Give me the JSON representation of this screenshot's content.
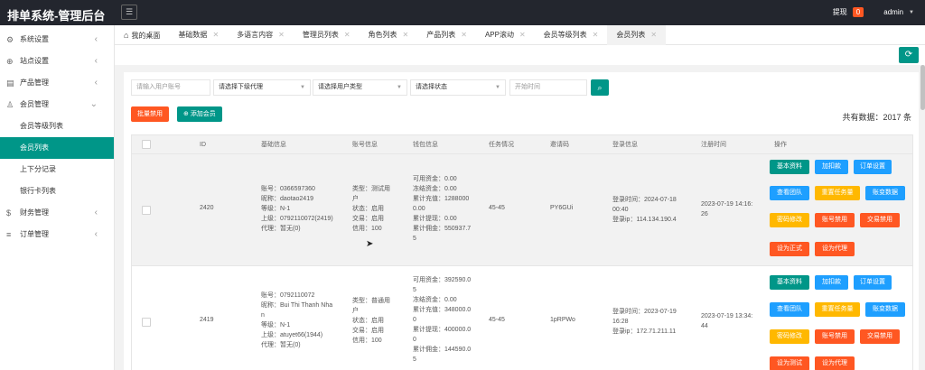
{
  "header": {
    "brand": "排单系统-管理后台",
    "menu_icon": "☰",
    "withdraw_label": "提现",
    "withdraw_count": "0",
    "user": "admin"
  },
  "sidebar": {
    "items": [
      {
        "label": "系统设置",
        "icon": "⚙"
      },
      {
        "label": "站点设置",
        "icon": "⊕"
      },
      {
        "label": "产品管理",
        "icon": "▤"
      },
      {
        "label": "会员管理",
        "icon": "♙"
      }
    ],
    "sub": [
      "会员等级列表",
      "会员列表",
      "上下分记录",
      "银行卡列表"
    ],
    "bottom": [
      {
        "label": "财务管理",
        "icon": "$"
      },
      {
        "label": "订单管理",
        "icon": "≡"
      }
    ]
  },
  "tabs": [
    "我的桌面",
    "基础数据",
    "多语言内容",
    "管理员列表",
    "角色列表",
    "产品列表",
    "APP滚动",
    "会员等级列表",
    "会员列表"
  ],
  "filters": {
    "account_placeholder": "请输入用户账号",
    "agent": "请选择下级代理",
    "user_type": "请选择用户类型",
    "status": "请选择状态",
    "start_time": "开始时间"
  },
  "actions": {
    "batch_disable": "批量禁用",
    "add_member": "添加会员",
    "total": "共有数据：2017 条"
  },
  "columns": [
    "ID",
    "基础信息",
    "账号信息",
    "钱包信息",
    "任务情况",
    "邀请码",
    "登录信息",
    "注册时间",
    "操作"
  ],
  "rows": [
    {
      "id": "2420",
      "basic": [
        "账号：0366597360",
        "昵称：daotao2419",
        "等级：N-1",
        "上级：0792110072(2419)",
        "代理：暂无(0)"
      ],
      "account": [
        "类型：测试用",
        "户",
        "状态：启用",
        "交易：启用",
        "信用：100"
      ],
      "wallet": [
        "可用资金：0.00",
        "冻结资金：0.00",
        "累计充值：1288000",
        "0.00",
        "累计提现：0.00",
        "累计佣金：550937.7",
        "5"
      ],
      "task": "45-45",
      "invite": "PY6GUi",
      "login": [
        "登录时间：2024-07-18",
        "00:40",
        "登录ip：114.134.190.4"
      ],
      "reg": [
        "2023-07-19 14:16:",
        "26"
      ],
      "ops": [
        [
          "基本资料",
          "加扣款",
          "订单设置"
        ],
        [
          "查看团队",
          "重置任务量",
          "账变数据"
        ],
        [
          "密码修改",
          "账号禁用",
          "交易禁用"
        ],
        [
          "设为正式",
          "设为代理"
        ]
      ]
    },
    {
      "id": "2419",
      "basic": [
        "账号：0792110072",
        "昵称：Bui Thi Thanh Nha",
        "n",
        "等级：N-1",
        "上级：atuyet66(1944)",
        "代理：暂无(0)"
      ],
      "account": [
        "类型：普通用",
        "户",
        "状态：启用",
        "交易：启用",
        "信用：100"
      ],
      "wallet": [
        "可用资金：392590.0",
        "5",
        "冻结资金：0.00",
        "累计充值：348000.0",
        "0",
        "累计提现：400000.0",
        "0",
        "累计佣金：144590.0",
        "5"
      ],
      "task": "45-45",
      "invite": "1pRPWo",
      "login": [
        "登录时间：2023-07-19",
        "16:28",
        "登录ip：172.71.211.11"
      ],
      "reg": [
        "2023-07-19 13:34:",
        "44"
      ],
      "ops": [
        [
          "基本资料",
          "加扣款",
          "订单设置"
        ],
        [
          "查看团队",
          "重置任务量",
          "账变数据"
        ],
        [
          "密码修改",
          "账号禁用",
          "交易禁用"
        ],
        [
          "设为测试",
          "设为代理"
        ]
      ]
    }
  ],
  "colors": {
    "teal": "#009688",
    "blue": "#1e9fff",
    "orange": "#ffb800",
    "red": "#ff5722",
    "topbar": "#23262e"
  }
}
